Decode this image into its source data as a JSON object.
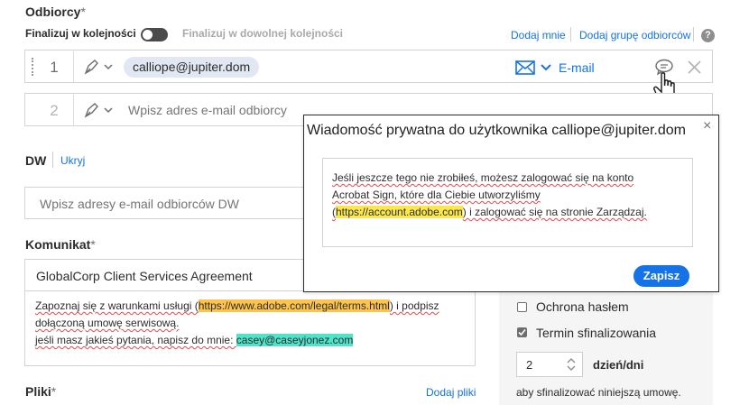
{
  "recipients": {
    "title": "Odbiorcy",
    "required_mark": "*",
    "finalize_in_order": "Finalizuj w kolejności",
    "finalize_any_order": "Finalizuj w dowolnej kolejności",
    "add_me": "Dodaj mnie",
    "add_group": "Dodaj grupę odbiorców",
    "help": "?",
    "rows": [
      {
        "number": "1",
        "email": "calliope@jupiter.dom",
        "delivery": "E-mail"
      },
      {
        "number": "2",
        "placeholder": "Wpisz adres e-mail odbiorcy"
      }
    ]
  },
  "cc": {
    "title": "DW",
    "hide_link": "Ukryj",
    "placeholder": "Wpisz adresy e-mail odbiorców DW"
  },
  "message": {
    "title": "Komunikat",
    "required_mark": "*",
    "subject": "GlobalCorp Client Services Agreement",
    "body": {
      "line1_pre": "Zapoznaj się z warunkami usługi (",
      "link": "https://www.adobe.com/legal/terms.html",
      "line1_post": ") i podpisz",
      "line2": "dołączoną umowę serwisową.",
      "line3_pre": "jeśli masz jakieś pytania, napisz do mnie: ",
      "email": "casey@caseyjonez.com"
    }
  },
  "files": {
    "title": "Pliki",
    "required_mark": "*",
    "add_files": "Dodaj pliki"
  },
  "options": {
    "password": "Ochrona hasłem",
    "deadline": "Termin sfinalizowania",
    "days_value": "2",
    "days_unit": "dzień/dni",
    "deadline_note": "aby sfinalizować niniejszą umowę."
  },
  "private_message": {
    "title": "Wiadomość prywatna do użytkownika calliope@jupiter.dom",
    "text_pre": "Jeśli jeszcze tego nie zrobiłeś, możesz zalogować się na konto Acrobat Sign, które dla Ciebie utworzyliśmy (",
    "link": "https://account.adobe.com",
    "text_post": ") i zalogować się na stronie Zarządzaj.",
    "save": "Zapisz",
    "close": "×"
  }
}
